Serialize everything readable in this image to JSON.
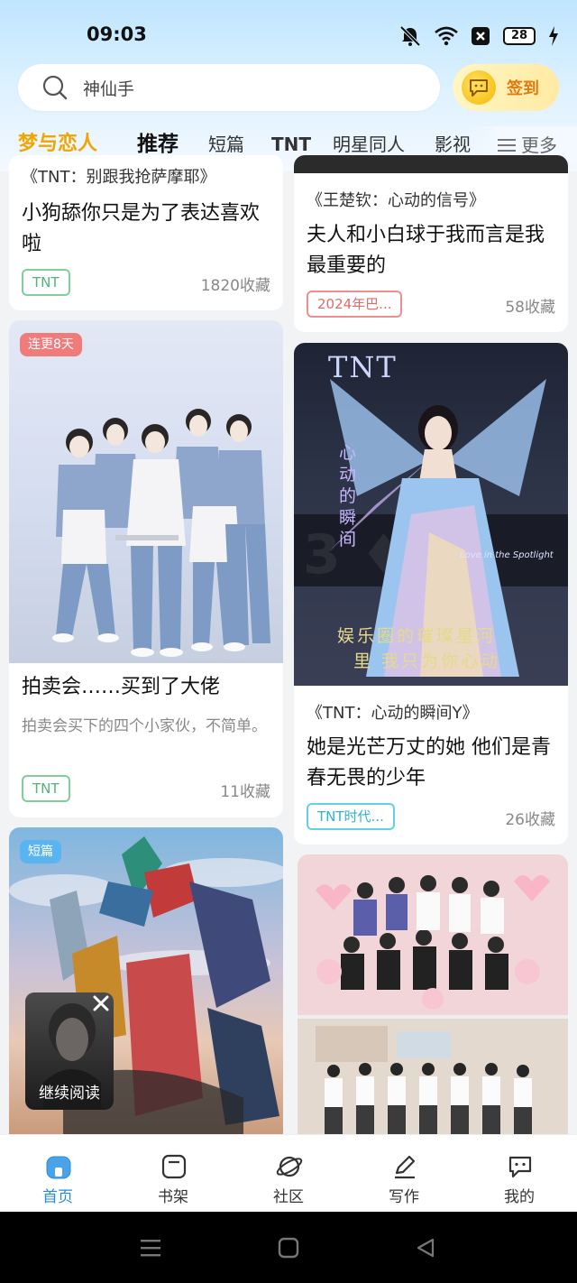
{
  "status_bar": {
    "time": "09:03",
    "battery": "28"
  },
  "search": {
    "placeholder": "神仙手",
    "signin_label": "签到"
  },
  "tabs": [
    "梦与恋人",
    "推荐",
    "短篇",
    "TNT",
    "明星同人",
    "影视",
    "更多"
  ],
  "feed": {
    "left": [
      {
        "book_ref": "《TNT：别跟我抢萨摩耶》",
        "title": "小狗舔你只是为了表达喜欢啦",
        "tag": "TNT",
        "collect": "1820收藏"
      },
      {
        "badge": "连更8天",
        "title": "拍卖会……买到了大佬",
        "desc": "拍卖会买下的四个小家伙，不简单。",
        "tag": "TNT",
        "collect": "11收藏"
      },
      {
        "badge": "短篇"
      }
    ],
    "right": [
      {
        "book_ref": "《王楚钦：心动的信号》",
        "title": "夫人和小白球于我而言是我最重要的",
        "tag": "2024年巴...",
        "collect": "58收藏"
      },
      {
        "cover_text_top": "TNT",
        "cover_text_side": "心动的瞬间",
        "cover_text_bottom1": "娱乐圈的璀璨星河",
        "cover_text_bottom2": "里 我只为你心动",
        "cover_text_small": "Love in the Spotlight",
        "book_ref": "《TNT：心动的瞬间Y》",
        "title": "她是光芒万丈的她 他们是青春无畏的少年",
        "tag": "TNT时代...",
        "collect": "26收藏"
      },
      {}
    ]
  },
  "continue_reading": {
    "label": "继续阅读"
  },
  "bottom_nav": [
    {
      "label": "首页",
      "icon": "home-icon",
      "active": true
    },
    {
      "label": "书架",
      "icon": "bookshelf-icon"
    },
    {
      "label": "社区",
      "icon": "planet-icon"
    },
    {
      "label": "写作",
      "icon": "pen-icon"
    },
    {
      "label": "我的",
      "icon": "chat-bubble-icon"
    }
  ],
  "colors": {
    "accent_blue": "#2a8cd8",
    "tab_active_gold": "#f0a500",
    "tag_green": "#53b377",
    "tag_red": "#e36a6a",
    "tag_teal": "#2fb3cf"
  }
}
